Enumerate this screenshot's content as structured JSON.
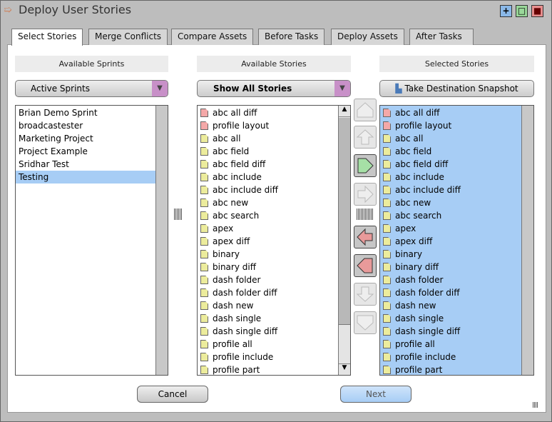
{
  "window": {
    "title": "Deploy User Stories",
    "buttons": [
      "+",
      "□",
      "■"
    ]
  },
  "tabs": [
    "Select Stories",
    "Merge Conflicts",
    "Compare Assets",
    "Before Tasks",
    "Deploy Assets",
    "After Tasks"
  ],
  "columns": {
    "sprints_header": "Available Sprints",
    "stories_header": "Available Stories",
    "selected_header": "Selected Stories"
  },
  "sprint_filter": "Active Sprints",
  "story_filter": "Show All Stories",
  "snapshot_label": "Take Destination Snapshot",
  "sprints": [
    "Brian Demo Sprint",
    "broadcastester",
    "Marketing Project",
    "Project Example",
    "Sridhar Test",
    "Testing"
  ],
  "selected_sprint": "Testing",
  "stories": [
    {
      "name": "abc all diff",
      "color": "pink"
    },
    {
      "name": "profile layout",
      "color": "pink"
    },
    {
      "name": "abc all",
      "color": "yellow"
    },
    {
      "name": "abc field",
      "color": "yellow"
    },
    {
      "name": "abc field diff",
      "color": "yellow"
    },
    {
      "name": "abc include",
      "color": "yellow"
    },
    {
      "name": "abc include diff",
      "color": "yellow"
    },
    {
      "name": "abc new",
      "color": "yellow"
    },
    {
      "name": "abc search",
      "color": "yellow"
    },
    {
      "name": "apex",
      "color": "yellow"
    },
    {
      "name": "apex diff",
      "color": "yellow"
    },
    {
      "name": "binary",
      "color": "yellow"
    },
    {
      "name": "binary diff",
      "color": "yellow"
    },
    {
      "name": "dash folder",
      "color": "yellow"
    },
    {
      "name": "dash folder diff",
      "color": "yellow"
    },
    {
      "name": "dash new",
      "color": "yellow"
    },
    {
      "name": "dash single",
      "color": "yellow"
    },
    {
      "name": "dash single diff",
      "color": "yellow"
    },
    {
      "name": "profile all",
      "color": "yellow"
    },
    {
      "name": "profile include",
      "color": "yellow"
    },
    {
      "name": "profile part",
      "color": "yellow"
    }
  ],
  "buttons": {
    "cancel": "Cancel",
    "next": "Next"
  },
  "colors": {
    "pink": "#f4a8a8",
    "yellow": "#ecec9c",
    "selection": "#a7cdf5"
  }
}
